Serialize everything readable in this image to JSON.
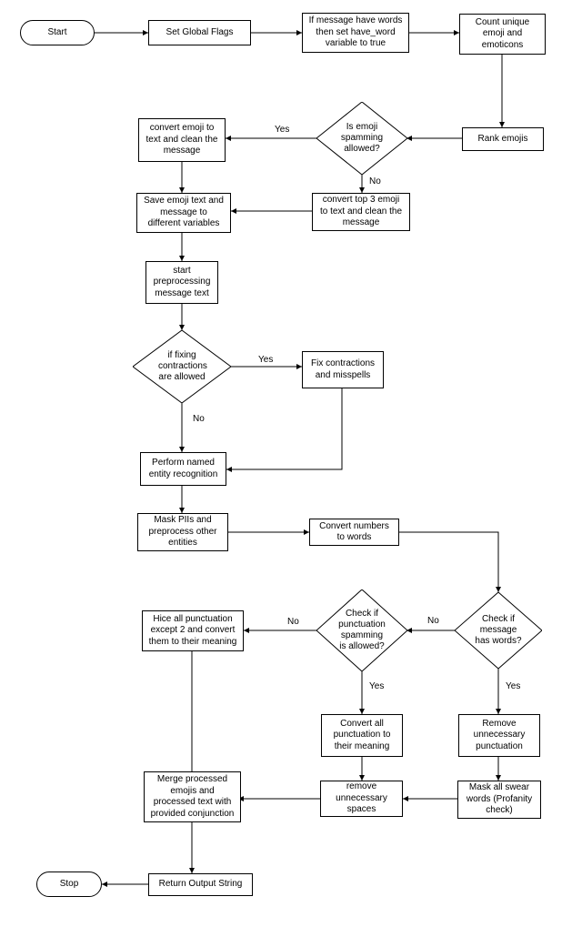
{
  "nodes": {
    "start": "Start",
    "setFlags": "Set Global Flags",
    "hasWords": "If message have words then set have_word variable to true",
    "countEmoji": "Count unique emoji and emoticons",
    "rankEmoji": "Rank emojis",
    "spamAllowed": "Is emoji spamming allowed?",
    "convertAll": "convert emoji to text and clean the message",
    "convertTop3": "convert top 3 emoji to text and clean the message",
    "saveVars": "Save emoji text and message to different variables",
    "startPre": "start preprocessing message text",
    "fixAllowed": "if fixing contractions are allowed",
    "fixContr": "Fix contractions and misspells",
    "ner": "Perform named entity recognition",
    "maskPII": "Mask PIIs and preprocess other entities",
    "numToWords": "Convert numbers to words",
    "msgHasWords": "Check if message has words?",
    "punctAllowed": "Check if punctuation spamming is allowed?",
    "hicePunct": "Hice all punctuation except 2 and convert them to their meaning",
    "convPunct": "Convert all punctuation to their meaning",
    "removeSpaces": "remove unnecessary spaces",
    "removePunct": "Remove unnecessary punctuation",
    "maskSwear": "Mask all swear words (Profanity check)",
    "merge": "Merge processed emojis and processed text with provided conjunction",
    "returnStr": "Return Output String",
    "stop": "Stop"
  },
  "labels": {
    "yes": "Yes",
    "no": "No"
  }
}
